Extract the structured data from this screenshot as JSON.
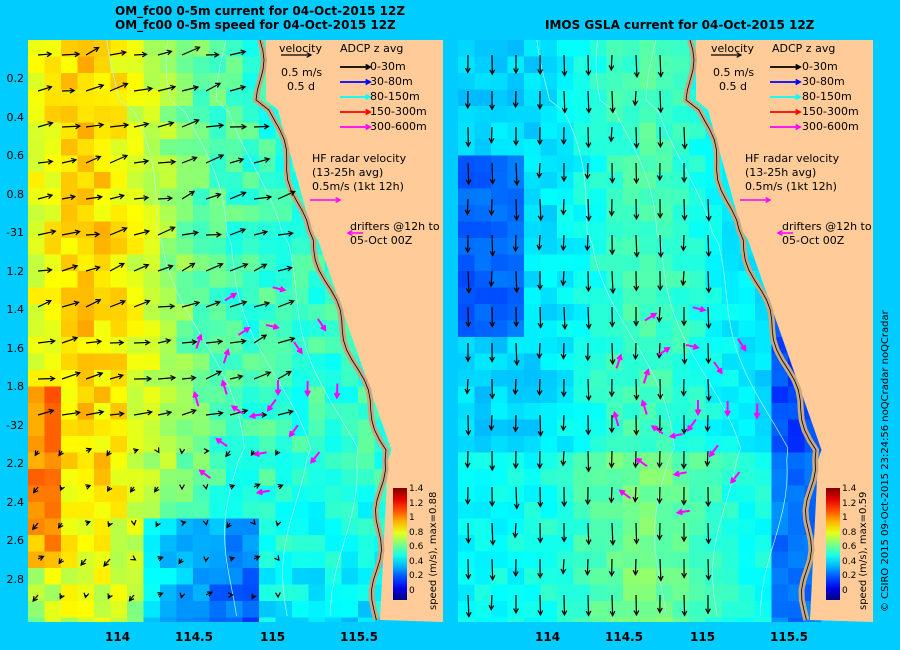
{
  "left_panel": {
    "title_line1": "OM_fc00 0-5m current for 04-Oct-2015 12Z",
    "title_line2": "OM_fc00 0-5m speed for 04-Oct-2015 12Z",
    "colorbar_label": "speed (m/s), max=0.88"
  },
  "right_panel": {
    "title_line1": "IMOS GSLA current for 04-Oct-2015 12Z",
    "colorbar_label": "speed (m/s), max=0.59"
  },
  "legend": {
    "velocity": "velocity",
    "scale": "0.5 m/s",
    "duration": "0.5 d",
    "adcp_title": "ADCP z avg",
    "adcp_items": [
      {
        "label": "0-30m",
        "color": "#000000"
      },
      {
        "label": "30-80m",
        "color": "#0000ff"
      },
      {
        "label": "80-150m",
        "color": "#00ffff"
      },
      {
        "label": "150-300m",
        "color": "#ff0000"
      },
      {
        "label": "300-600m",
        "color": "#ff00ff"
      }
    ],
    "hf_line1": "HF radar velocity",
    "hf_line2": "(13-25h avg)",
    "hf_line3": "0.5m/s (1kt 12h)",
    "drifters_line1": "drifters @12h to",
    "drifters_line2": "05-Oct 00Z"
  },
  "y_ticks": [
    "0.2",
    "0.4",
    "0.6",
    "0.8",
    "-31",
    "1.2",
    "1.4",
    "1.6",
    "1.8",
    "-32",
    "2.2",
    "2.4",
    "2.6",
    "2.8"
  ],
  "x_ticks": [
    "114",
    "114.5",
    "115",
    "115.5"
  ],
  "colorbar_ticks": [
    "1.4",
    "1.2",
    "1",
    "0.8",
    "0.6",
    "0.4",
    "0.2",
    "0"
  ],
  "credit": "© CSIRO 2015  09-Oct-2015 23:24:56 noQCradar noQCradar",
  "colors": {
    "background": "#00ccff",
    "land": "#ffcc99",
    "coast": "#c8a882",
    "hf_radar": "#ff00ff"
  }
}
